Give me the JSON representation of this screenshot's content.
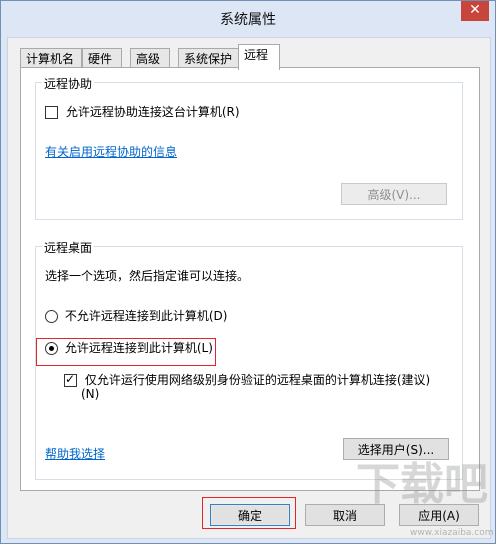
{
  "window": {
    "title": "系统属性",
    "close_glyph": "✕"
  },
  "tabs": [
    {
      "label": "计算机名"
    },
    {
      "label": "硬件"
    },
    {
      "label": "高级"
    },
    {
      "label": "系统保护"
    },
    {
      "label": "远程"
    }
  ],
  "remote_assistance": {
    "group_label": "远程协助",
    "allow_checkbox_label": "允许远程协助连接这台计算机(R)",
    "allow_checked": false,
    "info_link": "有关启用远程协助的信息",
    "advanced_button": "高级(V)..."
  },
  "remote_desktop": {
    "group_label": "远程桌面",
    "instruction": "选择一个选项，然后指定谁可以连接。",
    "option_deny": "不允许远程连接到此计算机(D)",
    "option_allow": "允许远程连接到此计算机(L)",
    "selected_option": "allow",
    "nla_checkbox_line1": "仅允许运行使用网络级别身份验证的远程桌面的计算机连接(建议)",
    "nla_checkbox_line2": "(N)",
    "nla_checked": true,
    "help_link": "帮助我选择",
    "select_users_button": "选择用户(S)..."
  },
  "footer": {
    "ok_button": "确定",
    "cancel_button": "取消",
    "apply_button": "应用(A)"
  },
  "colors": {
    "highlight_box": "#e0262a",
    "link": "#0066cc",
    "close_button": "#c7453a"
  }
}
